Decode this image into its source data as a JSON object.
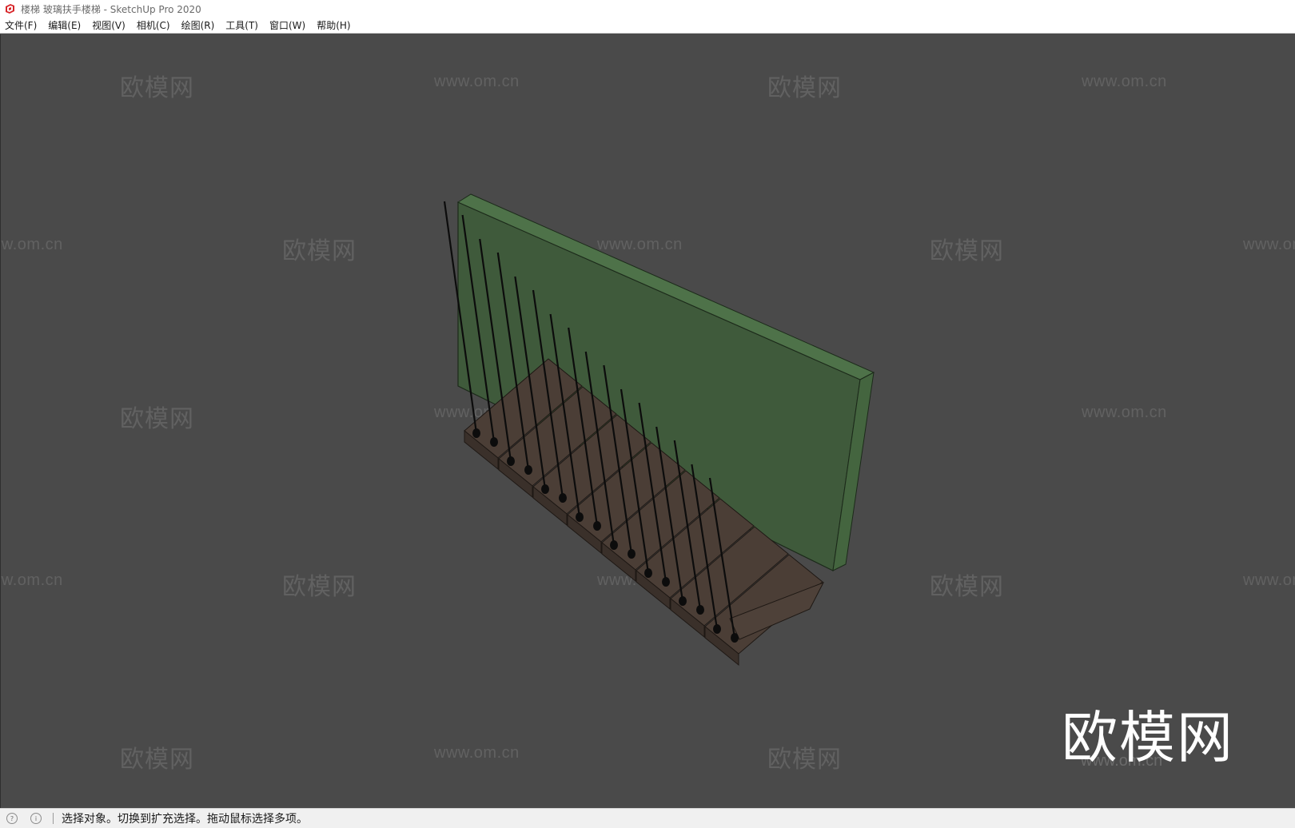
{
  "window": {
    "title": "楼梯 玻璃扶手楼梯 - SketchUp Pro 2020",
    "app_icon": "sketchup-logo-icon"
  },
  "menubar": {
    "items": [
      "文件(F)",
      "编辑(E)",
      "视图(V)",
      "相机(C)",
      "绘图(R)",
      "工具(T)",
      "窗口(W)",
      "帮助(H)"
    ]
  },
  "viewport": {
    "background_color": "#4a4a4a",
    "model": {
      "wall_color": "#3f5a3b",
      "wall_top_color": "#4e7249",
      "tread_color": "#4b3e36",
      "baluster_color": "#0c0c0c"
    },
    "watermarks": {
      "brand": "欧模网",
      "url": "www.om.cn"
    }
  },
  "statusbar": {
    "icons": [
      "geo-location-icon",
      "info-icon"
    ],
    "message": "选择对象。切换到扩充选择。拖动鼠标选择多项。"
  }
}
